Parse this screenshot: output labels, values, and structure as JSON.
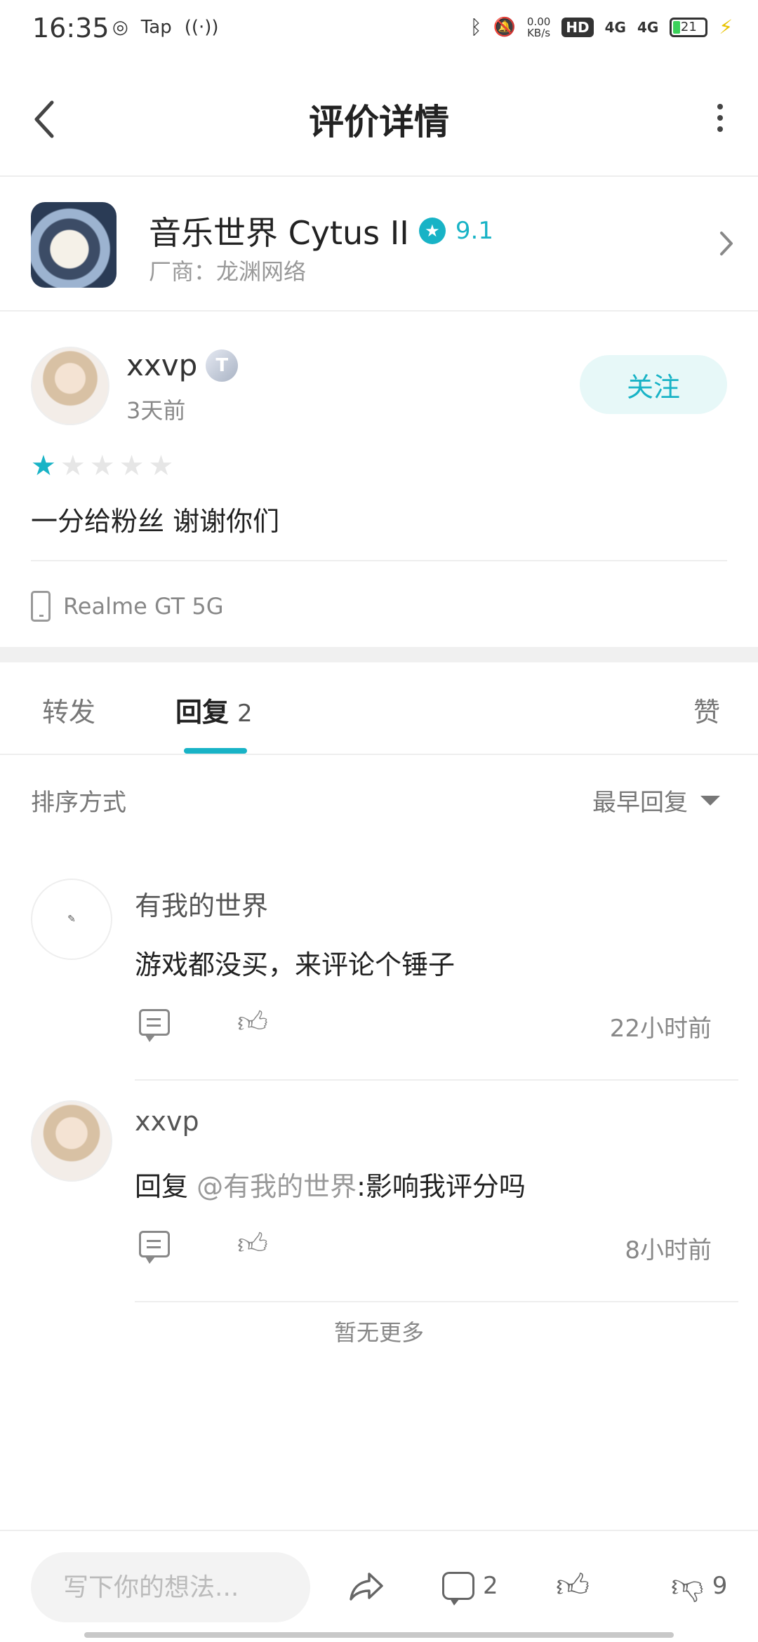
{
  "status_bar": {
    "time": "16:35",
    "left_icons": [
      "sync-icon",
      "tap-icon",
      "hotspot-icon"
    ],
    "tap_label": "Tap",
    "net_speed": "0.00",
    "net_unit": "KB/s",
    "hd_label": "HD",
    "signal_1": "4G",
    "signal_2": "4G",
    "battery": "21",
    "colors": {
      "battery_fill": "#3bd15a",
      "bolt": "#e8c300"
    }
  },
  "header": {
    "title": "评价详情"
  },
  "app": {
    "name": "音乐世界 Cytus II",
    "score": "9.1",
    "vendor": "厂商：龙渊网络"
  },
  "review": {
    "username": "xxvp",
    "level_badge": "T",
    "time": "3天前",
    "follow_label": "关注",
    "stars_total": 5,
    "stars_filled": 1,
    "content": "一分给粉丝 谢谢你们",
    "device": "Realme GT 5G"
  },
  "tabs": {
    "forward": "转发",
    "reply": "回复",
    "reply_count": "2",
    "like": "赞"
  },
  "sort": {
    "label": "排序方式",
    "value": "最早回复"
  },
  "replies": [
    {
      "username": "有我的世界",
      "text": "游戏都没买，来评论个锤子",
      "time": "22小时前"
    },
    {
      "username": "xxvp",
      "prefix": "回复",
      "mention": "@有我的世界",
      "text": ":影响我评分吗",
      "time": "8小时前"
    }
  ],
  "no_more": "暂无更多",
  "bottom_bar": {
    "input_placeholder": "写下你的想法...",
    "comment_count": "2",
    "dislike_count": "9"
  },
  "theme": {
    "accent": "#18b3c6",
    "follow_bg": "#e7f8f8"
  }
}
